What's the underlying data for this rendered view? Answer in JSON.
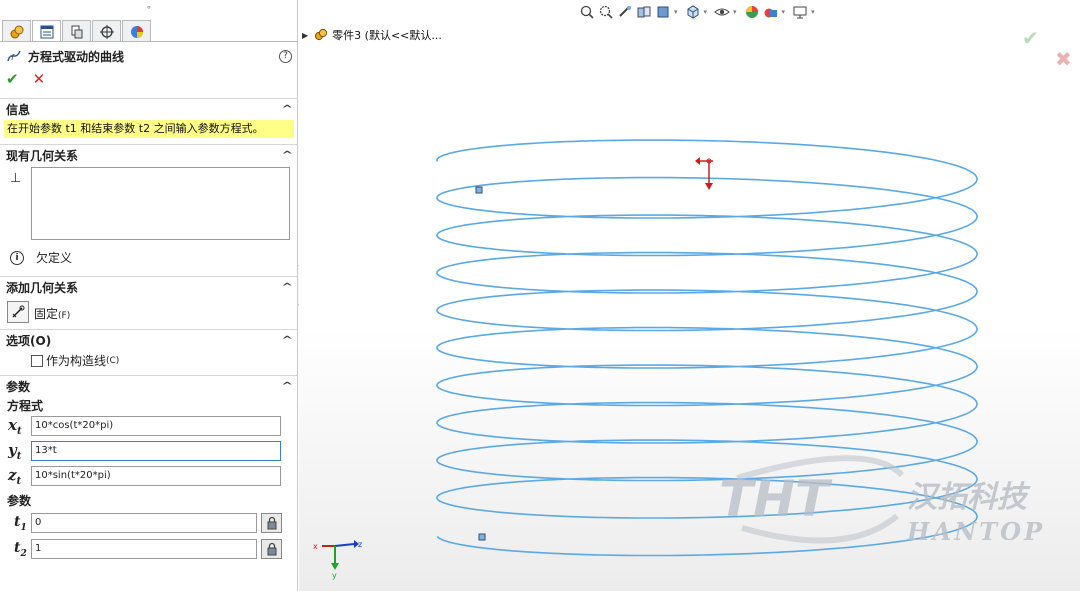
{
  "panel": {
    "feature_title": "方程式驱动的曲线",
    "help_glyph": "?",
    "ok_glyph": "✔",
    "cancel_glyph": "✕",
    "info": {
      "header": "信息",
      "message": "在开始参数 t1 和结束参数 t2 之间输入参数方程式。"
    },
    "existing_relations": {
      "header": "现有几何关系",
      "status": "欠定义"
    },
    "add_relations": {
      "header": "添加几何关系",
      "fix_label": "固定",
      "fix_key": "(F)"
    },
    "options": {
      "header": "选项",
      "header_key": "(O)",
      "construction_label": "作为构造线",
      "construction_key": "(C)",
      "construction_checked": false
    },
    "parameters": {
      "header": "参数",
      "equations_label": "方程式",
      "x_sym": "x",
      "x_sub": "t",
      "x_value": "10*cos(t*20*pi)",
      "y_sym": "y",
      "y_sub": "t",
      "y_value": "13*t",
      "z_sym": "z",
      "z_sub": "t",
      "z_value": "10*sin(t*20*pi)",
      "params_label": "参数",
      "t1_sym": "t",
      "t1_sub": "1",
      "t1_value": "0",
      "t2_sym": "t",
      "t2_sub": "2",
      "t2_value": "1"
    }
  },
  "viewport": {
    "tree_item": "零件3 (默认<<默认...",
    "triad_x": "x",
    "triad_z": "z",
    "triad_y": "y",
    "watermark_latin": "THT",
    "watermark_cn": "汉拓科技",
    "watermark_en": "HANTOP",
    "curve_color": "#5aa9e6",
    "turns": 10
  }
}
